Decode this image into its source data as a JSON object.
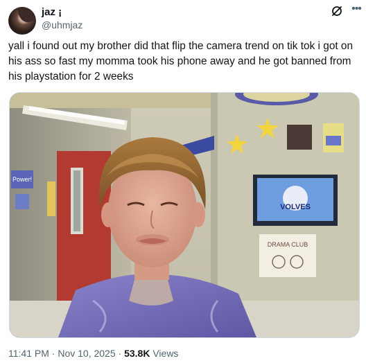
{
  "author": {
    "display_name": "jaz ¡",
    "handle": "@uhmjaz"
  },
  "tweet": {
    "text": "yall i found out my brother did that flip the camera trend on tik tok i got on his ass so fast my momma took his phone away and he got banned from his playstation for 2 weeks"
  },
  "media": {
    "signs": {
      "door_poster": "Power!",
      "tv_logo": "VOLVES",
      "paper_sign": "DRAMA CLUB"
    }
  },
  "meta": {
    "time": "11:41 PM",
    "separator": " · ",
    "date": "Nov 10, 2025",
    "views_count": "53.8K",
    "views_label": " Views"
  },
  "colors": {
    "text": "#0f1419",
    "secondary": "#536471",
    "border": "#cfd9de"
  },
  "icons": [
    "avatar",
    "grok-icon",
    "more-icon"
  ]
}
